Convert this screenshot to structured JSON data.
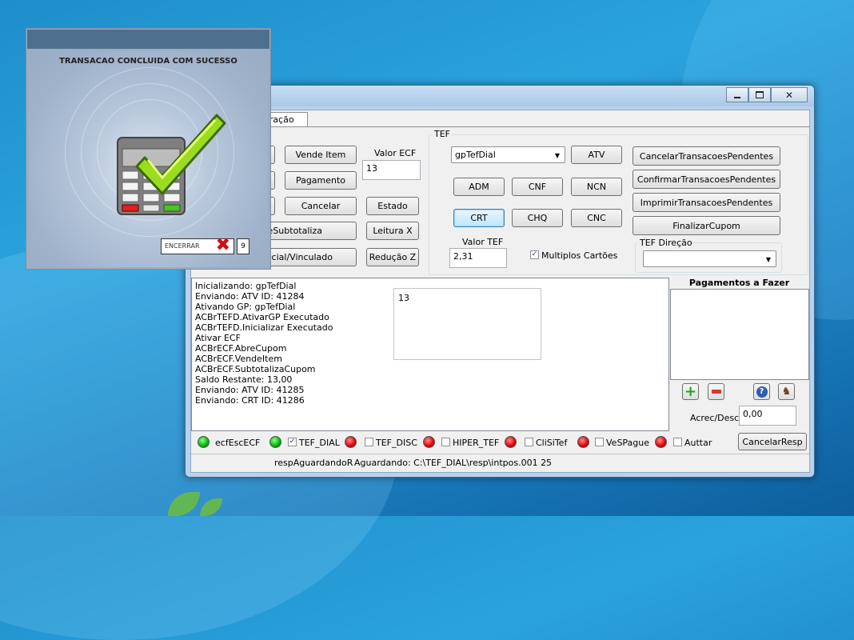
{
  "dialog": {
    "title": "TRANSACAO CONCLUIDA COM SUCESSO",
    "encerrar_label": "ENCERRAR",
    "counter": "9"
  },
  "window": {
    "tab_label": "eração",
    "buttons_left_col2": {
      "vende_item": "Vende Item",
      "pagamento": "Pagamento",
      "cancelar": "Cancelar",
      "subtotaliza": "deSubtotaliza",
      "vinculado": "encial/Vinculado"
    },
    "buttons_left_col3": {
      "estado": "Estado",
      "leitura_x": "Leitura X",
      "reducao_z": "Redução Z"
    },
    "valor_ecf": {
      "label": "Valor ECF",
      "value": "13"
    },
    "tef": {
      "group_label": "TEF",
      "gp_selected": "gpTefDial",
      "atv": "ATV",
      "adm": "ADM",
      "cnf": "CNF",
      "ncn": "NCN",
      "crt": "CRT",
      "chq": "CHQ",
      "cnc": "CNC",
      "valor_tef_label": "Valor TEF",
      "valor_tef_value": "2,31",
      "multiplos_label": "Multiplos Cartões",
      "multiplos_checked": true,
      "cancelar_pend": "CancelarTransacoesPendentes",
      "confirmar_pend": "ConfirmarTransacoesPendentes",
      "imprimir_pend": "ImprimirTransacoesPendentes",
      "finalizar_cupom": "FinalizarCupom",
      "direcao_label": "TEF Direção",
      "direcao_value": ""
    },
    "log_lines": [
      "Inicializando: gpTefDial",
      "Enviando: ATV ID: 41284",
      "Ativando GP: gpTefDial",
      "ACBrTEFD.AtivarGP Executado",
      "ACBrTEFD.Inicializar Executado",
      "Ativar ECF",
      "ACBrECF.AbreCupom",
      "ACBrECF.VendeItem",
      "ACBrECF.SubtotalizaCupom",
      "Saldo Restante: 13,00",
      "Enviando: ATV ID: 41285",
      "Enviando: CRT ID: 41286"
    ],
    "memo2_text": "13",
    "pagamentos": {
      "header": "Pagamentos a Fazer",
      "acrec_label": "Acrec/Desc",
      "acrec_value": "0,00"
    },
    "indicators": [
      {
        "label": "ecfEscECF",
        "status": "green",
        "has_check": false
      },
      {
        "label": "TEF_DIAL",
        "status": "green",
        "has_check": true,
        "checked": true
      },
      {
        "label": "TEF_DISC",
        "status": "red",
        "has_check": true,
        "checked": false
      },
      {
        "label": "HIPER_TEF",
        "status": "red",
        "has_check": true,
        "checked": false
      },
      {
        "label": "CliSiTef",
        "status": "red",
        "has_check": true,
        "checked": false
      },
      {
        "label": "VeSPague",
        "status": "red",
        "has_check": true,
        "checked": false
      },
      {
        "label": "Auttar",
        "status": "red",
        "has_check": true,
        "checked": false
      }
    ],
    "cancelar_resp": "CancelarResp",
    "status": {
      "state": "respAguardandoR",
      "message": "Aguardando: C:\\TEF_DIAL\\resp\\intpos.001 25"
    }
  },
  "colors": {
    "led_green": "#00b400",
    "led_red": "#e00000",
    "accent": "#3c7fb1"
  }
}
